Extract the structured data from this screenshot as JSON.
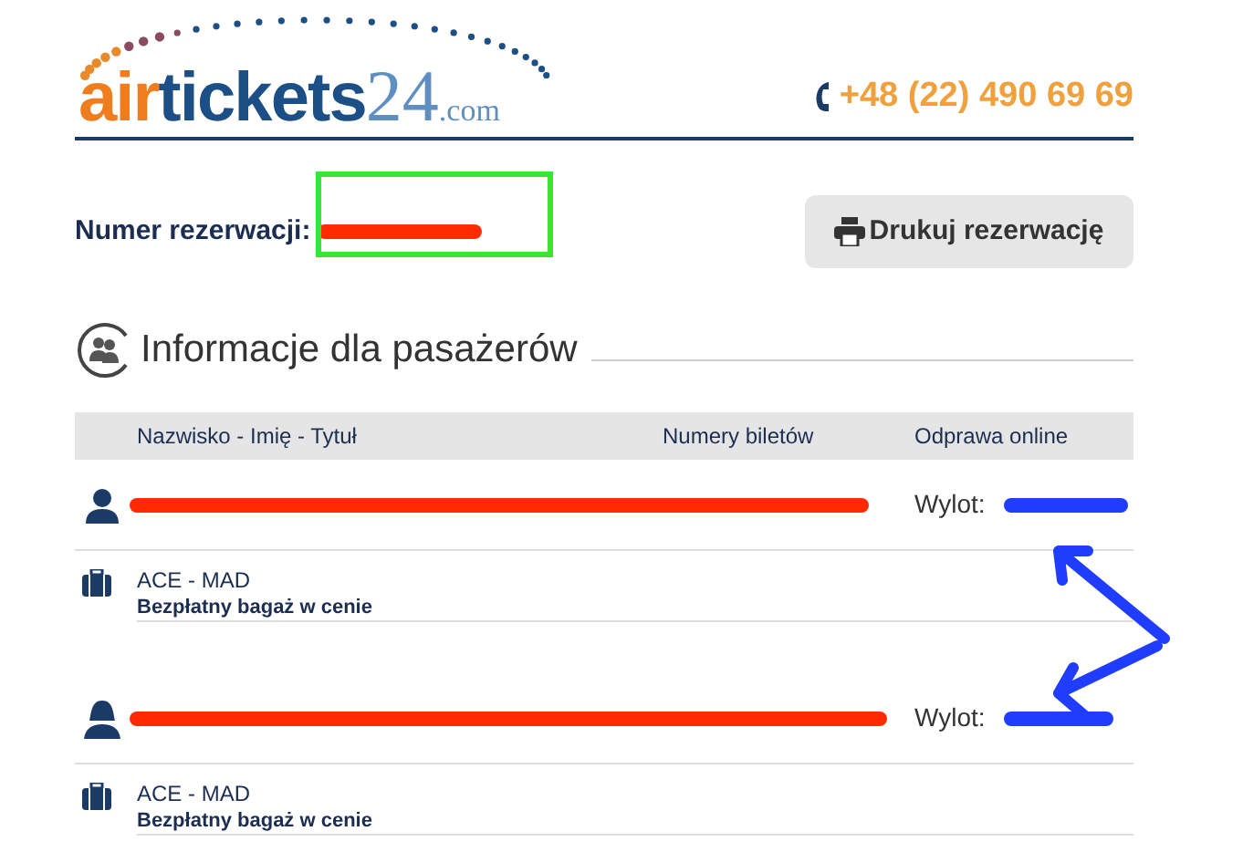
{
  "logo": {
    "parts": [
      "air",
      "tickets",
      "24",
      ".com"
    ]
  },
  "phone": "+48 (22) 490 69 69",
  "reservation": {
    "label": "Numer rezerwacji:",
    "redacted": true,
    "highlighted": true
  },
  "print_button": "Drukuj rezerwację",
  "section_title": "Informacje dla pasażerów",
  "table": {
    "columns": [
      "Nazwisko - Imię - Tytuł",
      "Numery biletów",
      "Odprawa online"
    ],
    "passengers": [
      {
        "kind": "male",
        "checkin_label": "Wylot:",
        "route": "ACE - MAD",
        "baggage": "Bezpłatny bagaż w cenie"
      },
      {
        "kind": "female",
        "checkin_label": "Wylot:",
        "route": "ACE - MAD",
        "baggage": "Bezpłatny bagaż w cenie"
      }
    ]
  }
}
